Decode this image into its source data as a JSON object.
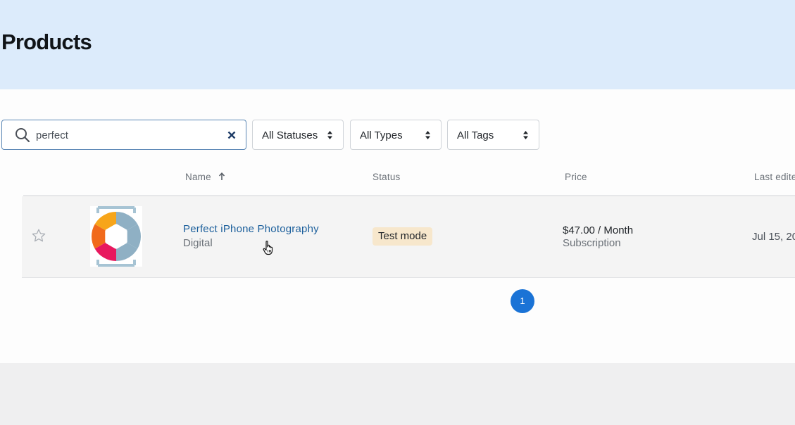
{
  "page": {
    "title": "Products"
  },
  "filters": {
    "search_value": "perfect",
    "statuses": "All Statuses",
    "types": "All Types",
    "tags": "All Tags"
  },
  "columns": {
    "name": "Name",
    "status": "Status",
    "price": "Price",
    "last_edited": "Last edite"
  },
  "rows": [
    {
      "name": "Perfect iPhone Photography",
      "type": "Digital",
      "status": "Test mode",
      "price": "$47.00 / Month",
      "price_kind": "Subscription",
      "last_edited": "Jul 15, 20"
    }
  ],
  "pagination": {
    "current": "1"
  },
  "colors": {
    "link": "#1a5e9b",
    "accent": "#1a73d6",
    "badge": "#f7e7cc",
    "header": "#dcebfb"
  },
  "icons": [
    "search-icon",
    "clear-icon",
    "sort-caret-icon",
    "sort-ascending-icon",
    "star-icon",
    "product-thumbnail",
    "pointer-cursor-icon"
  ]
}
